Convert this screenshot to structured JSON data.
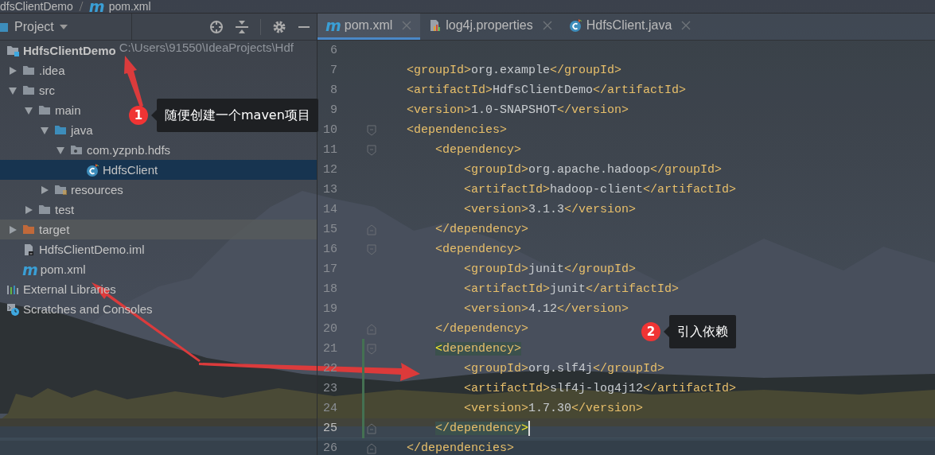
{
  "breadcrumb": [
    {
      "label": "dfsClientDemo"
    },
    {
      "label": "pom.xml",
      "glyph": "m"
    }
  ],
  "project_panel": {
    "title": "Project",
    "tree": [
      {
        "label": "HdfsClientDemo",
        "kind": "module",
        "path": "C:\\Users\\91550\\IdeaProjects\\Hdf",
        "selected": false,
        "children": [
          {
            "label": ".idea",
            "kind": "folder",
            "expanded": false,
            "selected": false
          },
          {
            "label": "src",
            "kind": "folder",
            "expanded": true,
            "selected": false,
            "children": [
              {
                "label": "main",
                "kind": "folder",
                "expanded": true,
                "selected": false,
                "children": [
                  {
                    "label": "java",
                    "kind": "source",
                    "expanded": true,
                    "selected": false,
                    "children": [
                      {
                        "label": "com.yzpnb.hdfs",
                        "kind": "package",
                        "expanded": true,
                        "selected": false,
                        "children": [
                          {
                            "label": "HdfsClient",
                            "kind": "class",
                            "selected": true
                          }
                        ]
                      }
                    ]
                  },
                  {
                    "label": "resources",
                    "kind": "resources",
                    "expanded": false,
                    "selected": false
                  }
                ]
              },
              {
                "label": "test",
                "kind": "folder",
                "expanded": false,
                "selected": false
              }
            ]
          },
          {
            "label": "target",
            "kind": "excluded",
            "expanded": false,
            "selected": false,
            "hovered": true
          },
          {
            "label": "HdfsClientDemo.iml",
            "kind": "iml",
            "selected": false
          },
          {
            "label": "pom.xml",
            "kind": "maven",
            "glyph": "m",
            "selected": false
          }
        ]
      },
      {
        "label": "External Libraries",
        "kind": "libraries",
        "selected": false
      },
      {
        "label": "Scratches and Consoles",
        "kind": "scratches",
        "selected": false
      }
    ]
  },
  "editor": {
    "tabs": [
      {
        "label": "pom.xml",
        "kind": "maven",
        "glyph": "m",
        "selected": true
      },
      {
        "label": "log4j.properties",
        "kind": "properties",
        "selected": false
      },
      {
        "label": "HdfsClient.java",
        "kind": "class",
        "selected": false
      }
    ],
    "lines": [
      {
        "number": "6",
        "changed": false
      },
      {
        "number": "7",
        "code": "    <groupId>org.example</groupId>",
        "changed": false
      },
      {
        "number": "8",
        "code": "    <artifactId>HdfsClientDemo</artifactId>",
        "changed": false
      },
      {
        "number": "9",
        "code": "    <version>1.0-SNAPSHOT</version>",
        "changed": false
      },
      {
        "number": "10",
        "code": "    <dependencies>",
        "fold_open": true,
        "changed": false
      },
      {
        "number": "11",
        "code": "        <dependency>",
        "fold_open": true,
        "changed": false
      },
      {
        "number": "12",
        "code": "            <groupId>org.apache.hadoop</groupId>",
        "changed": false
      },
      {
        "number": "13",
        "code": "            <artifactId>hadoop-client</artifactId>",
        "changed": false
      },
      {
        "number": "14",
        "code": "            <version>3.1.3</version>",
        "changed": false
      },
      {
        "number": "15",
        "code": "        </dependency>",
        "fold_close": true,
        "changed": false
      },
      {
        "number": "16",
        "code": "        <dependency>",
        "fold_open": true,
        "changed": false
      },
      {
        "number": "17",
        "code": "            <groupId>junit</groupId>",
        "changed": false
      },
      {
        "number": "18",
        "code": "            <artifactId>junit</artifactId>",
        "changed": false
      },
      {
        "number": "19",
        "code": "            <version>4.12</version>",
        "changed": false
      },
      {
        "number": "20",
        "code": "        </dependency>",
        "fold_close": true,
        "changed": false
      },
      {
        "number": "21",
        "code": "        <dependency>",
        "fold_open": true,
        "brace_match": true,
        "changed": true
      },
      {
        "number": "22",
        "code": "            <groupId>org.slf4j</groupId>",
        "changed": true
      },
      {
        "number": "23",
        "code": "            <artifactId>slf4j-log4j12</artifactId>",
        "changed": true
      },
      {
        "number": "24",
        "code": "            <version>1.7.30</version>",
        "changed": true
      },
      {
        "number": "25",
        "code": "        </dependency>",
        "fold_close": true,
        "brace_match": true,
        "current": true,
        "changed": true
      },
      {
        "number": "26",
        "code": "    </dependencies>",
        "fold_close": true,
        "changed": false
      }
    ]
  },
  "annotations": [
    {
      "number": "1",
      "text": "随便创建一个maven项目"
    },
    {
      "number": "2",
      "text": "引入依赖"
    }
  ]
}
